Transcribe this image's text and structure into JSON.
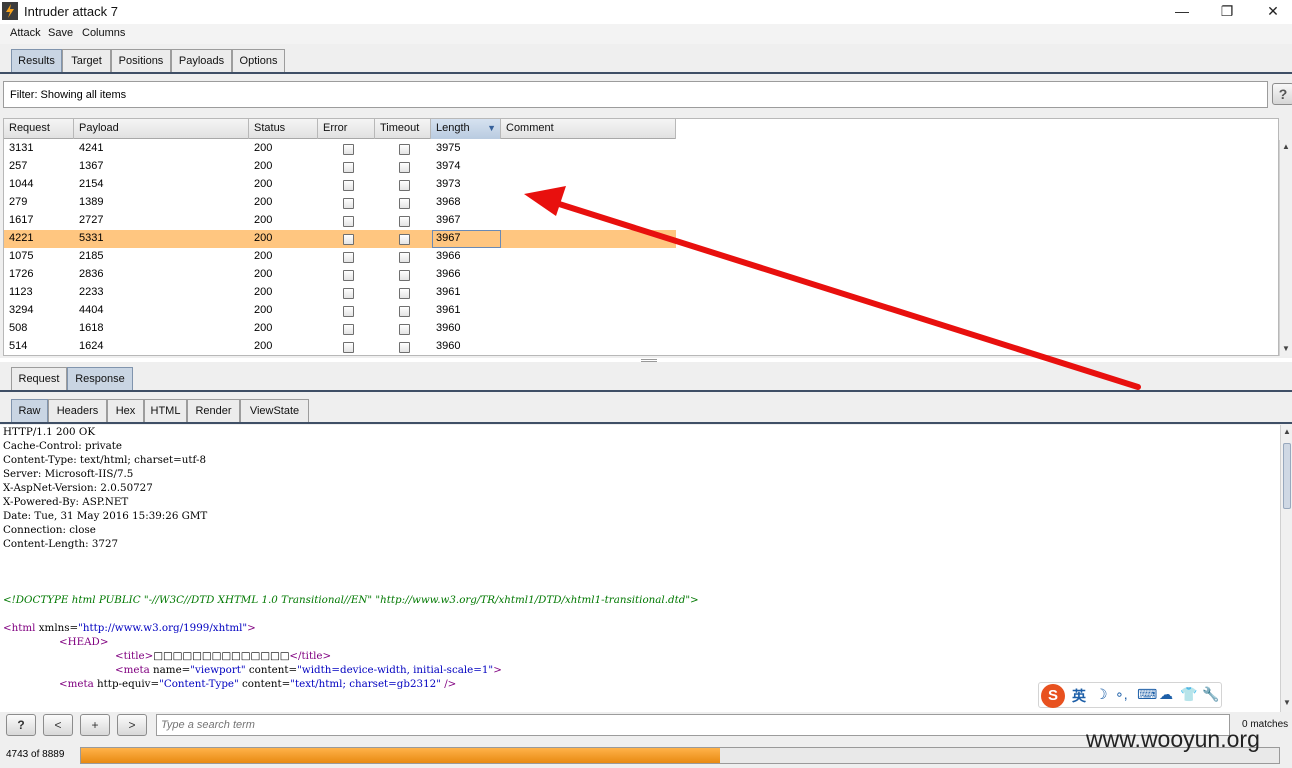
{
  "window": {
    "title": "Intruder attack 7",
    "minimize_glyph": "—",
    "maximize_glyph": "❐",
    "close_glyph": "✕"
  },
  "menu": {
    "items": [
      "Attack",
      "Save",
      "Columns"
    ]
  },
  "main_tabs": [
    {
      "label": "Results",
      "active": true
    },
    {
      "label": "Target",
      "active": false
    },
    {
      "label": "Positions",
      "active": false
    },
    {
      "label": "Payloads",
      "active": false
    },
    {
      "label": "Options",
      "active": false
    }
  ],
  "filter": {
    "text": "Filter: Showing all items",
    "help_label": "?"
  },
  "results_table": {
    "columns": [
      "Request",
      "Payload",
      "Status",
      "Error",
      "Timeout",
      "Length",
      "Comment"
    ],
    "sorted_column": "Length",
    "sort_glyph": "▼",
    "selected_row_index": 5,
    "rows": [
      {
        "request": "3131",
        "payload": "4241",
        "status": "200",
        "error": false,
        "timeout": false,
        "length": "3975",
        "comment": ""
      },
      {
        "request": "257",
        "payload": "1367",
        "status": "200",
        "error": false,
        "timeout": false,
        "length": "3974",
        "comment": ""
      },
      {
        "request": "1044",
        "payload": "2154",
        "status": "200",
        "error": false,
        "timeout": false,
        "length": "3973",
        "comment": ""
      },
      {
        "request": "279",
        "payload": "1389",
        "status": "200",
        "error": false,
        "timeout": false,
        "length": "3968",
        "comment": ""
      },
      {
        "request": "1617",
        "payload": "2727",
        "status": "200",
        "error": false,
        "timeout": false,
        "length": "3967",
        "comment": ""
      },
      {
        "request": "4221",
        "payload": "5331",
        "status": "200",
        "error": false,
        "timeout": false,
        "length": "3967",
        "comment": ""
      },
      {
        "request": "1075",
        "payload": "2185",
        "status": "200",
        "error": false,
        "timeout": false,
        "length": "3966",
        "comment": ""
      },
      {
        "request": "1726",
        "payload": "2836",
        "status": "200",
        "error": false,
        "timeout": false,
        "length": "3966",
        "comment": ""
      },
      {
        "request": "1123",
        "payload": "2233",
        "status": "200",
        "error": false,
        "timeout": false,
        "length": "3961",
        "comment": ""
      },
      {
        "request": "3294",
        "payload": "4404",
        "status": "200",
        "error": false,
        "timeout": false,
        "length": "3961",
        "comment": ""
      },
      {
        "request": "508",
        "payload": "1618",
        "status": "200",
        "error": false,
        "timeout": false,
        "length": "3960",
        "comment": ""
      },
      {
        "request": "514",
        "payload": "1624",
        "status": "200",
        "error": false,
        "timeout": false,
        "length": "3960",
        "comment": ""
      }
    ]
  },
  "message_tabs": [
    {
      "label": "Request",
      "active": false
    },
    {
      "label": "Response",
      "active": true
    }
  ],
  "view_tabs": [
    {
      "label": "Raw",
      "active": true
    },
    {
      "label": "Headers",
      "active": false
    },
    {
      "label": "Hex",
      "active": false
    },
    {
      "label": "HTML",
      "active": false
    },
    {
      "label": "Render",
      "active": false
    },
    {
      "label": "ViewState",
      "active": false
    }
  ],
  "response": {
    "headers": [
      "HTTP/1.1 200 OK",
      "Cache-Control: private",
      "Content-Type: text/html; charset=utf-8",
      "Server: Microsoft-IIS/7.5",
      "X-AspNet-Version: 2.0.50727",
      "X-Powered-By: ASP.NET",
      "Date: Tue, 31 May 2016 15:39:26 GMT",
      "Connection: close",
      "Content-Length: 3727"
    ],
    "doctype": "<!DOCTYPE html PUBLIC \"-//W3C//DTD XHTML 1.0 Transitional//EN\" \"http://www.w3.org/TR/xhtml1/DTD/xhtml1-transitional.dtd\">",
    "html_open_tag": "<html",
    "html_xmlns_attr": " xmlns=",
    "html_xmlns_value": "\"http://www.w3.org/1999/xhtml\"",
    "html_close_bracket": ">",
    "head_tag": "<HEAD>",
    "title_open": "<title>",
    "title_content": "□□□□□□□□□□□□□□",
    "title_close": "</title>",
    "meta1_open": "<meta",
    "meta1_name_attr": " name=",
    "meta1_name_value": "\"viewport\"",
    "meta1_content_attr": " content=",
    "meta1_content_value": "\"width=device-width, initial-scale=1\"",
    "meta1_close": ">",
    "meta2_open": "<meta",
    "meta2_equiv_attr": " http-equiv=",
    "meta2_equiv_value": "\"Content-Type\"",
    "meta2_content_attr": " content=",
    "meta2_content_value": "\"text/html; charset=gb2312\"",
    "meta2_close": " />"
  },
  "ime_toolbar": {
    "logo": "S",
    "lang": "英",
    "icons": [
      "☽",
      "∘,",
      "⌨",
      "☁",
      "👕",
      "🔧"
    ]
  },
  "search": {
    "help_label": "?",
    "prev_label": "<",
    "add_label": "+",
    "next_label": ">",
    "placeholder": "Type a search term",
    "matches": "0 matches"
  },
  "status": {
    "progress_text": "4743 of 8889",
    "progress_done": 4743,
    "progress_total": 8889
  },
  "watermark": "www.wooyun.org",
  "colors": {
    "selected_row": "#ffc680",
    "progress": "#f0961e",
    "annotation_arrow": "#e8100e"
  }
}
